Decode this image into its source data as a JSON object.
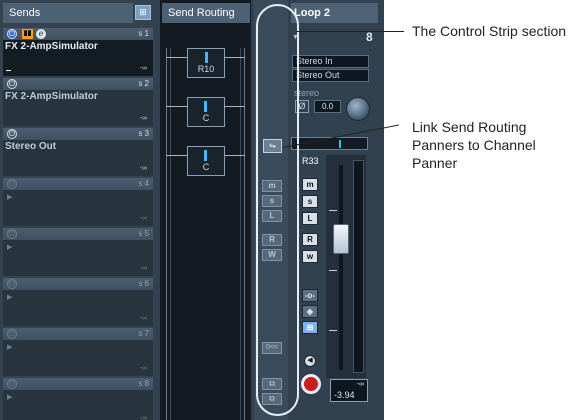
{
  "sends": {
    "header": "Sends",
    "slots": [
      {
        "number": "s 1",
        "destination": "FX 2-AmpSimulator",
        "level": "-∞"
      },
      {
        "number": "s 2",
        "destination": "FX 2-AmpSimulator",
        "level": "-∞"
      },
      {
        "number": "s 3",
        "destination": "Stereo Out",
        "level": "-∞"
      },
      {
        "number": "s 4",
        "destination": "",
        "level": "-∞"
      },
      {
        "number": "s 5",
        "destination": "",
        "level": "-∞"
      },
      {
        "number": "s 6",
        "destination": "",
        "level": "-∞"
      },
      {
        "number": "s 7",
        "destination": "",
        "level": "-∞"
      },
      {
        "number": "s 8",
        "destination": "",
        "level": "-∞"
      }
    ]
  },
  "routing": {
    "header": "Send Routing",
    "panners": [
      "R10",
      "C",
      "C"
    ]
  },
  "control_strip": {
    "buttons": [
      "m",
      "s",
      "L",
      "R",
      "W"
    ],
    "reset_label": "0<<"
  },
  "channel": {
    "name": "Loop 2",
    "number": "8",
    "input": "Stereo In",
    "output": "Stereo Out",
    "config": "stereo",
    "phase": "Ø",
    "gain": "0.0",
    "pan_label": "R33",
    "buttons": [
      "m",
      "s",
      "L",
      "R",
      "w"
    ],
    "fader_top": "-∞",
    "fader_value": "-3.94"
  },
  "annotations": {
    "control_strip": "The Control Strip section",
    "link_send": "Link Send Routing Panners to Channel Panner"
  }
}
